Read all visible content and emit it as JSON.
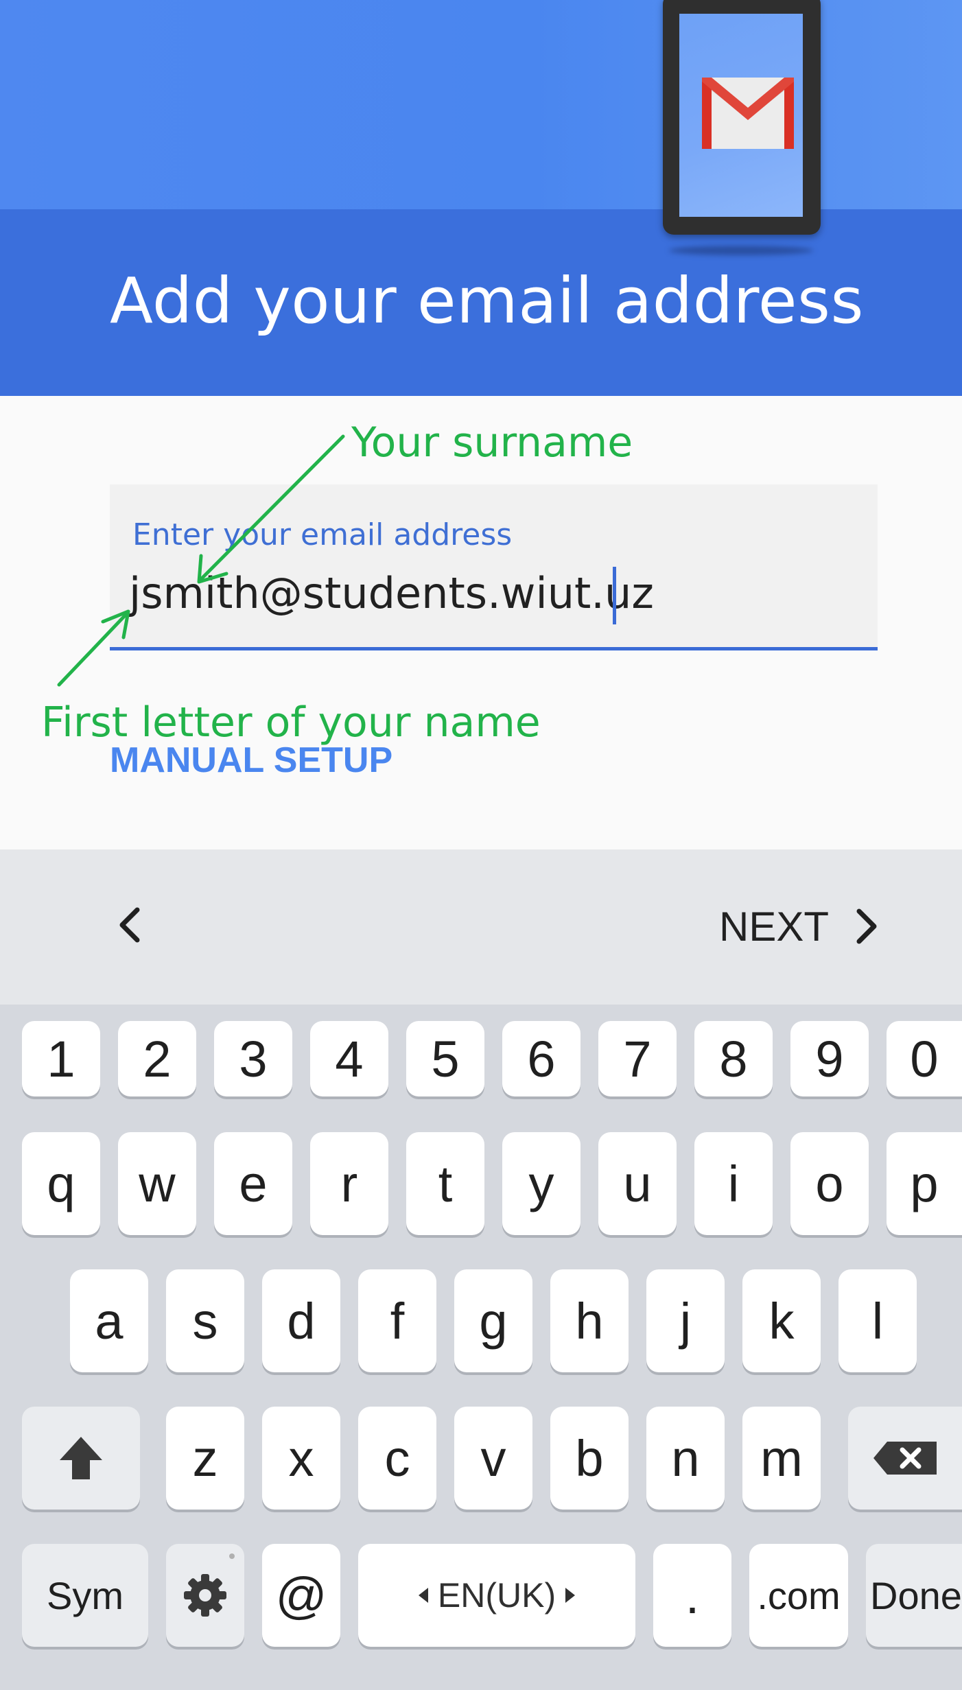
{
  "header": {
    "title": "Add your email address",
    "brand_colors": {
      "header_blue": "#3b6fdc",
      "sky_blue": "#4f88f0",
      "logo_red": "#d93025"
    },
    "illustration": "gmail-phone-illustration"
  },
  "form": {
    "label": "Enter your email address",
    "email_value": "jsmith@students.wiut.uz",
    "manual_setup_label": "MANUAL SETUP"
  },
  "annotations": {
    "surname": "Your surname",
    "first_letter": "First letter of your name",
    "color": "#22b34a"
  },
  "nav": {
    "back_icon": "chevron-left-icon",
    "next_label": "NEXT",
    "next_icon": "chevron-right-icon"
  },
  "keyboard": {
    "row_numbers": [
      "1",
      "2",
      "3",
      "4",
      "5",
      "6",
      "7",
      "8",
      "9",
      "0"
    ],
    "row_top": [
      "q",
      "w",
      "e",
      "r",
      "t",
      "y",
      "u",
      "i",
      "o",
      "p"
    ],
    "row_middle": [
      "a",
      "s",
      "d",
      "f",
      "g",
      "h",
      "j",
      "k",
      "l"
    ],
    "row_bottom": [
      "z",
      "x",
      "c",
      "v",
      "b",
      "n",
      "m"
    ],
    "shift_icon": "shift-arrow-icon",
    "backspace_icon": "backspace-icon",
    "sym_label": "Sym",
    "settings_icon": "gear-icon",
    "at_label": "@",
    "space_label": "EN(UK)",
    "period_label": ".",
    "dotcom_label": ".com",
    "done_label": "Done"
  }
}
